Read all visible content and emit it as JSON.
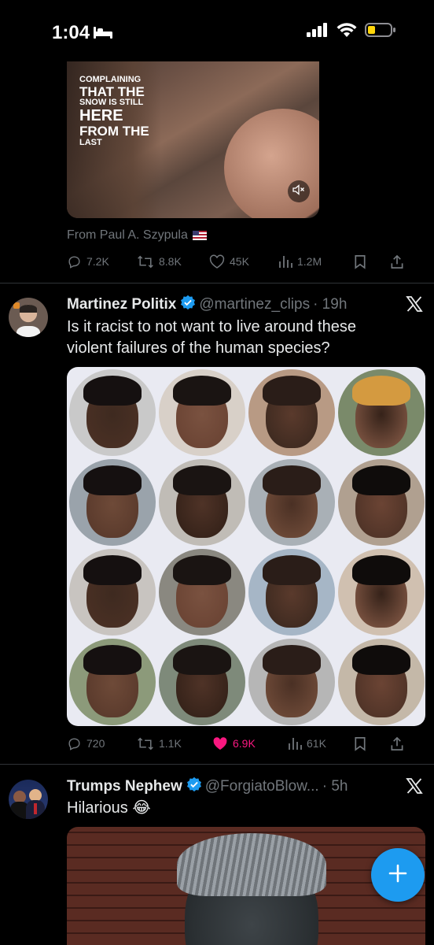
{
  "status_bar": {
    "time": "1:04"
  },
  "tweet1": {
    "caption": [
      "COMPLAINING",
      "THAT THE",
      "SNOW IS STILL",
      "HERE",
      "FROM THE",
      "LAST"
    ],
    "from_text": "From Paul A. Szypula",
    "replies": "7.2K",
    "retweets": "8.8K",
    "likes": "45K",
    "views": "1.2M"
  },
  "tweet2": {
    "name": "Martinez Politix",
    "handle": "@martinez_clips",
    "time": "· 19h",
    "text_line1": "Is it racist to not want to live around these",
    "text_line2": "violent failures of the human species?",
    "replies": "720",
    "retweets": "1.1K",
    "likes": "6.9K",
    "views": "61K",
    "liked": true
  },
  "tweet3": {
    "name": "Trumps Nephew",
    "handle": "@ForgiatoBlow...",
    "time": "· 5h",
    "text": "Hilarious 😂"
  },
  "colors": {
    "accent": "#1d9bf0",
    "like": "#f91880",
    "muted": "#71767b",
    "gold_check": "#1d9bf0"
  },
  "icons": [
    "bed-icon",
    "signal-icon",
    "wifi-icon",
    "battery-icon",
    "mute-icon",
    "reply-icon",
    "retweet-icon",
    "like-icon",
    "views-icon",
    "bookmark-icon",
    "share-icon",
    "verified-icon",
    "x-logo-icon",
    "compose-plus-icon"
  ]
}
